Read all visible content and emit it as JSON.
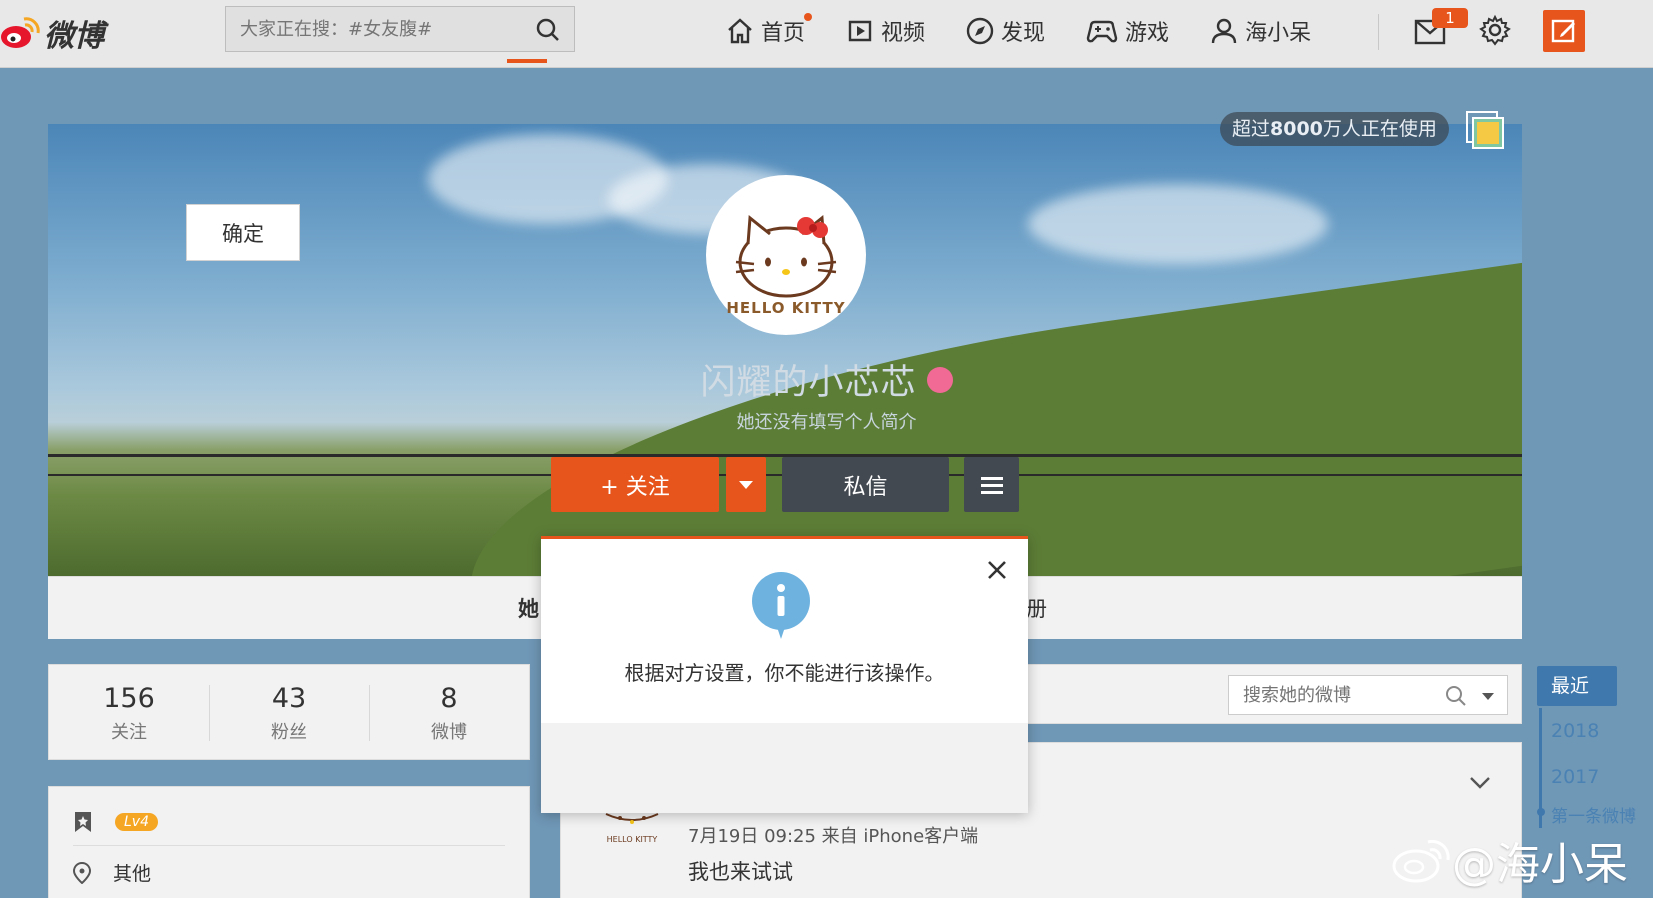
{
  "nav": {
    "logo_text": "微博",
    "search_placeholder": "大家正在搜：#女友腹#",
    "items": [
      {
        "label": "首页",
        "icon": "home-icon",
        "dot": true
      },
      {
        "label": "视频",
        "icon": "video-icon"
      },
      {
        "label": "发现",
        "icon": "compass-icon"
      },
      {
        "label": "游戏",
        "icon": "gamepad-icon"
      },
      {
        "label": "海小呆",
        "icon": "user-icon"
      }
    ],
    "mail_badge": "1",
    "accent_color": "#e8551c"
  },
  "cover": {
    "users_badge_prefix": "超过",
    "users_badge_number": "8000",
    "users_badge_suffix": "万人正在使用",
    "avatar_caption": "HELLO KITTY",
    "name": "闪耀的小芯芯",
    "bio": "她还没有填写个人简介",
    "follow_label": "+ 关注",
    "message_label": "私信"
  },
  "tabs": {
    "first": "她",
    "last": "册"
  },
  "stats": [
    {
      "value": "156",
      "label": "关注"
    },
    {
      "value": "43",
      "label": "粉丝"
    },
    {
      "value": "8",
      "label": "微博"
    }
  ],
  "info": {
    "level": "Lv4",
    "location": "其他"
  },
  "feed": {
    "search_placeholder": "搜索她的微博",
    "post_meta": "7月19日 09:25 来自 iPhone客户端",
    "post_text": "我也来试试",
    "avatar_caption": "HELLO KITTY"
  },
  "timeline": {
    "recent": "最近",
    "years": [
      "2018",
      "2017"
    ],
    "first_post": "第一条微博"
  },
  "modal": {
    "message": "根据对方设置，你不能进行该操作。",
    "ok_label": "确定"
  },
  "watermark": "@海小呆"
}
